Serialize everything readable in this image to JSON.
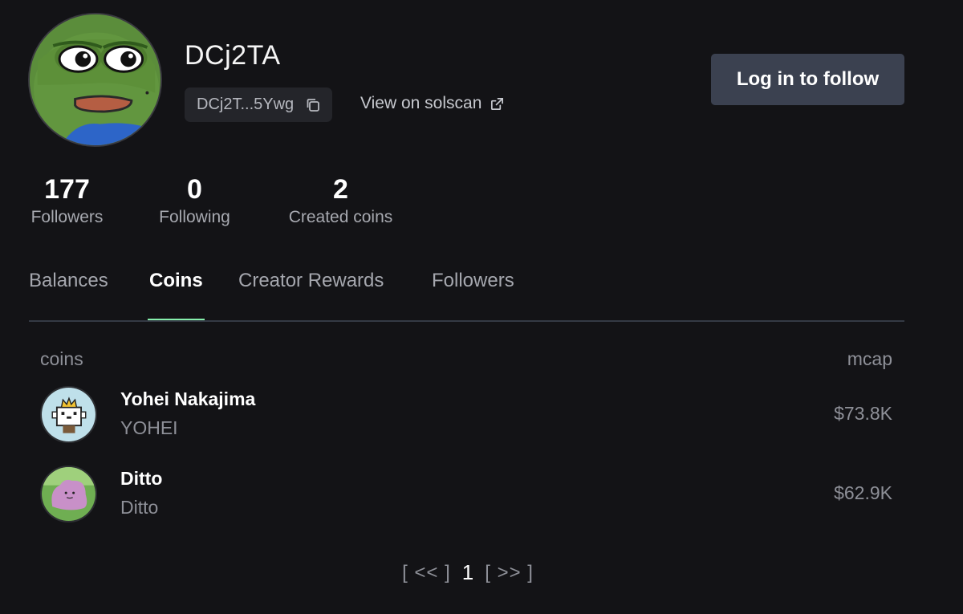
{
  "profile": {
    "username": "DCj2TA",
    "address_short": "DCj2T...5Ywg",
    "solscan_label": "View on solscan",
    "follow_button": "Log in to follow"
  },
  "stats": {
    "followers": {
      "value": "177",
      "label": "Followers"
    },
    "following": {
      "value": "0",
      "label": "Following"
    },
    "created": {
      "value": "2",
      "label": "Created coins"
    }
  },
  "tabs": [
    {
      "label": "Balances",
      "active": false
    },
    {
      "label": "Coins",
      "active": true
    },
    {
      "label": "Creator Rewards",
      "active": false
    },
    {
      "label": "Followers",
      "active": false
    }
  ],
  "table": {
    "col_coins": "coins",
    "col_mcap": "mcap",
    "rows": [
      {
        "name": "Yohei Nakajima",
        "ticker": "YOHEI",
        "mcap": "$73.8K"
      },
      {
        "name": "Ditto",
        "ticker": "Ditto",
        "mcap": "$62.9K"
      }
    ]
  },
  "pagination": {
    "prev": "[ << ]",
    "current": "1",
    "next": "[ >> ]"
  },
  "colors": {
    "background": "#131316",
    "accent_tab_underline": "#86efac",
    "button_bg": "#3b4150"
  },
  "icons": [
    "copy-icon",
    "external-link-icon"
  ]
}
